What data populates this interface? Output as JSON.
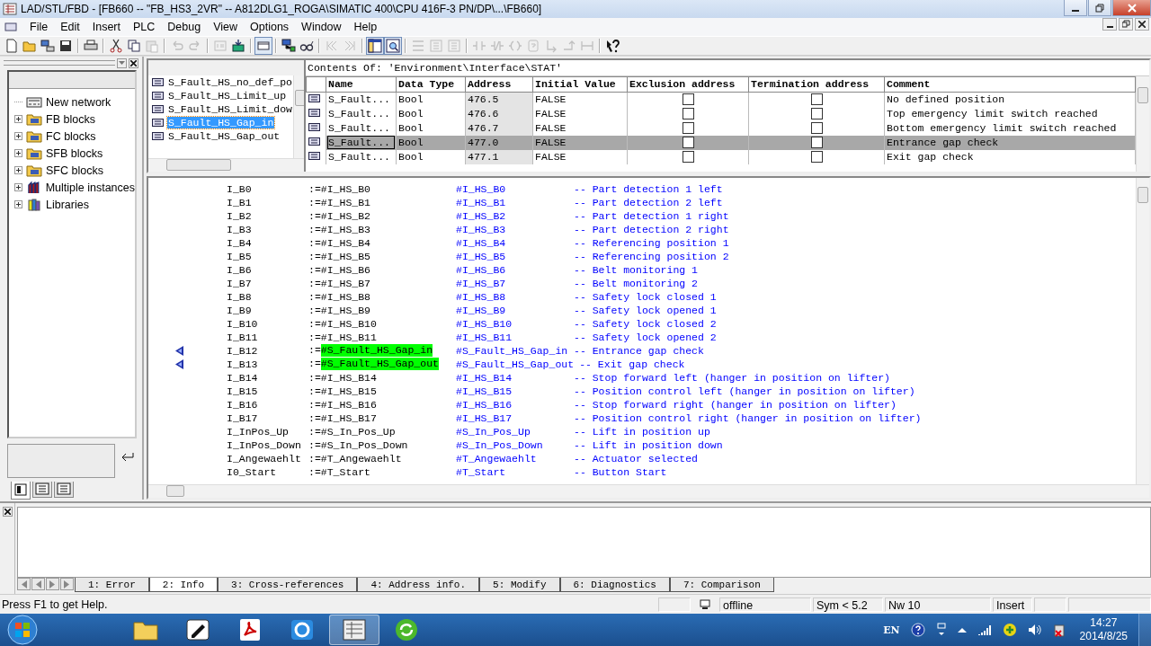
{
  "window": {
    "title": "LAD/STL/FBD  - [FB660 -- \"FB_HS3_2VR\" -- A812DLG1_ROGA\\SIMATIC 400\\CPU 416F-3 PN/DP\\...\\FB660]"
  },
  "menu": [
    "File",
    "Edit",
    "Insert",
    "PLC",
    "Debug",
    "View",
    "Options",
    "Window",
    "Help"
  ],
  "toolbar": [
    [
      {
        "kind": "new",
        "disabled": false,
        "pressed": false
      },
      {
        "kind": "open",
        "disabled": false,
        "pressed": false
      },
      {
        "kind": "nodes",
        "disabled": false,
        "pressed": false
      },
      {
        "kind": "save",
        "disabled": false,
        "pressed": false
      }
    ],
    [
      {
        "kind": "print",
        "disabled": false,
        "pressed": false
      }
    ],
    [
      {
        "kind": "cut",
        "disabled": false,
        "pressed": false
      },
      {
        "kind": "copy",
        "disabled": false,
        "pressed": false
      },
      {
        "kind": "paste",
        "disabled": true,
        "pressed": false
      }
    ],
    [
      {
        "kind": "undo",
        "disabled": true,
        "pressed": false
      },
      {
        "kind": "redo",
        "disabled": true,
        "pressed": false
      }
    ],
    [
      {
        "kind": "compile",
        "disabled": true,
        "pressed": false
      },
      {
        "kind": "download",
        "disabled": false,
        "pressed": false
      }
    ],
    [
      {
        "kind": "window",
        "disabled": false,
        "pressed": true
      }
    ],
    [
      {
        "kind": "network",
        "disabled": false,
        "pressed": false
      },
      {
        "kind": "glasses",
        "disabled": false,
        "pressed": false
      }
    ],
    [
      {
        "kind": "prev",
        "disabled": true,
        "pressed": false
      },
      {
        "kind": "next",
        "disabled": true,
        "pressed": false
      }
    ],
    [
      {
        "kind": "panel",
        "disabled": false,
        "pressed": true
      },
      {
        "kind": "zoom",
        "disabled": false,
        "pressed": true
      }
    ],
    [
      {
        "kind": "rung",
        "disabled": true,
        "pressed": false
      },
      {
        "kind": "branch",
        "disabled": true,
        "pressed": false
      },
      {
        "kind": "branch",
        "disabled": true,
        "pressed": false
      }
    ],
    [
      {
        "kind": "contact",
        "disabled": true,
        "pressed": false
      },
      {
        "kind": "ncontact",
        "disabled": true,
        "pressed": false
      },
      {
        "kind": "coil",
        "disabled": true,
        "pressed": false
      },
      {
        "kind": "box",
        "disabled": true,
        "pressed": false
      },
      {
        "kind": "open-branch",
        "disabled": true,
        "pressed": false
      },
      {
        "kind": "close-branch",
        "disabled": true,
        "pressed": false
      },
      {
        "kind": "jump",
        "disabled": true,
        "pressed": false
      }
    ],
    [
      {
        "kind": "help",
        "disabled": false,
        "pressed": false
      }
    ]
  ],
  "catalog": {
    "tree": [
      {
        "label": "New network",
        "kind": "network",
        "expandable": false
      },
      {
        "label": "FB blocks",
        "kind": "folder",
        "expandable": true
      },
      {
        "label": "FC blocks",
        "kind": "folder",
        "expandable": true
      },
      {
        "label": "SFB blocks",
        "kind": "folder",
        "expandable": true
      },
      {
        "label": "SFC blocks",
        "kind": "folder",
        "expandable": true
      },
      {
        "label": "Multiple instances",
        "kind": "instances",
        "expandable": true
      },
      {
        "label": "Libraries",
        "kind": "library",
        "expandable": true
      }
    ],
    "tabs": [
      {
        "kind": "catalog",
        "selected": true
      },
      {
        "kind": "list",
        "selected": false
      },
      {
        "kind": "list",
        "selected": false
      }
    ]
  },
  "interface": {
    "items": [
      {
        "label": "S_Fault_HS_no_def_po",
        "selected": false
      },
      {
        "label": "S_Fault_HS_Limit_up",
        "selected": false
      },
      {
        "label": "S_Fault_HS_Limit_dow",
        "selected": false
      },
      {
        "label": "S_Fault_HS_Gap_in",
        "selected": true
      },
      {
        "label": "S_Fault_HS_Gap_out",
        "selected": false
      }
    ],
    "header": "Contents Of: 'Environment\\Interface\\STAT'",
    "columns": [
      "Name",
      "Data Type",
      "Address",
      "Initial Value",
      "Exclusion address",
      "Termination address",
      "Comment"
    ],
    "rows": [
      {
        "name": "S_Fault...",
        "type": "Bool",
        "address": "476.5",
        "initial": "FALSE",
        "exclusion": false,
        "termination": false,
        "comment": "No defined position",
        "selected": false
      },
      {
        "name": "S_Fault...",
        "type": "Bool",
        "address": "476.6",
        "initial": "FALSE",
        "exclusion": false,
        "termination": false,
        "comment": "Top emergency limit switch reached",
        "selected": false
      },
      {
        "name": "S_Fault...",
        "type": "Bool",
        "address": "476.7",
        "initial": "FALSE",
        "exclusion": false,
        "termination": false,
        "comment": "Bottom emergency limit switch reached",
        "selected": false
      },
      {
        "name": "S_Fault...",
        "type": "Bool",
        "address": "477.0",
        "initial": "FALSE",
        "exclusion": false,
        "termination": false,
        "comment": "Entrance gap check",
        "selected": true
      },
      {
        "name": "S_Fault...",
        "type": "Bool",
        "address": "477.1",
        "initial": "FALSE",
        "exclusion": false,
        "termination": false,
        "comment": "Exit gap check",
        "selected": false
      }
    ]
  },
  "code": [
    {
      "param": "I_B0",
      "op": ":=",
      "value": "#I_HS_B0",
      "actual": "#I_HS_B0",
      "comment": "-- Part detection 1 left",
      "marked": false,
      "highlighted": false
    },
    {
      "param": "I_B1",
      "op": ":=",
      "value": "#I_HS_B1",
      "actual": "#I_HS_B1",
      "comment": "-- Part detection 2 left",
      "marked": false,
      "highlighted": false
    },
    {
      "param": "I_B2",
      "op": ":=",
      "value": "#I_HS_B2",
      "actual": "#I_HS_B2",
      "comment": "-- Part detection 1 right",
      "marked": false,
      "highlighted": false
    },
    {
      "param": "I_B3",
      "op": ":=",
      "value": "#I_HS_B3",
      "actual": "#I_HS_B3",
      "comment": "-- Part detection 2 right",
      "marked": false,
      "highlighted": false
    },
    {
      "param": "I_B4",
      "op": ":=",
      "value": "#I_HS_B4",
      "actual": "#I_HS_B4",
      "comment": "-- Referencing position 1",
      "marked": false,
      "highlighted": false
    },
    {
      "param": "I_B5",
      "op": ":=",
      "value": "#I_HS_B5",
      "actual": "#I_HS_B5",
      "comment": "-- Referencing position 2",
      "marked": false,
      "highlighted": false
    },
    {
      "param": "I_B6",
      "op": ":=",
      "value": "#I_HS_B6",
      "actual": "#I_HS_B6",
      "comment": "-- Belt monitoring 1",
      "marked": false,
      "highlighted": false
    },
    {
      "param": "I_B7",
      "op": ":=",
      "value": "#I_HS_B7",
      "actual": "#I_HS_B7",
      "comment": "-- Belt monitoring 2",
      "marked": false,
      "highlighted": false
    },
    {
      "param": "I_B8",
      "op": ":=",
      "value": "#I_HS_B8",
      "actual": "#I_HS_B8",
      "comment": "-- Safety lock closed 1",
      "marked": false,
      "highlighted": false
    },
    {
      "param": "I_B9",
      "op": ":=",
      "value": "#I_HS_B9",
      "actual": "#I_HS_B9",
      "comment": "-- Safety lock opened 1",
      "marked": false,
      "highlighted": false
    },
    {
      "param": "I_B10",
      "op": ":=",
      "value": "#I_HS_B10",
      "actual": "#I_HS_B10",
      "comment": "-- Safety lock closed 2",
      "marked": false,
      "highlighted": false
    },
    {
      "param": "I_B11",
      "op": ":=",
      "value": "#I_HS_B11",
      "actual": "#I_HS_B11",
      "comment": "-- Safety lock opened 2",
      "marked": false,
      "highlighted": false
    },
    {
      "param": "I_B12",
      "op": ":=",
      "value": "#S_Fault_HS_Gap_in",
      "actual": "#S_Fault_HS_Gap_in",
      "comment": "-- Entrance gap check",
      "marked": true,
      "highlighted": true
    },
    {
      "param": "I_B13",
      "op": ":=",
      "value": "#S_Fault_HS_Gap_out",
      "actual": "#S_Fault_HS_Gap_out",
      "comment": "-- Exit gap check",
      "marked": true,
      "highlighted": true
    },
    {
      "param": "I_B14",
      "op": ":=",
      "value": "#I_HS_B14",
      "actual": "#I_HS_B14",
      "comment": "-- Stop forward left (hanger in position on lifter)",
      "marked": false,
      "highlighted": false
    },
    {
      "param": "I_B15",
      "op": ":=",
      "value": "#I_HS_B15",
      "actual": "#I_HS_B15",
      "comment": "-- Position control left (hanger in position on lifter)",
      "marked": false,
      "highlighted": false
    },
    {
      "param": "I_B16",
      "op": ":=",
      "value": "#I_HS_B16",
      "actual": "#I_HS_B16",
      "comment": "-- Stop forward right (hanger in position on lifter)",
      "marked": false,
      "highlighted": false
    },
    {
      "param": "I_B17",
      "op": ":=",
      "value": "#I_HS_B17",
      "actual": "#I_HS_B17",
      "comment": "-- Position control right (hanger in position on lifter)",
      "marked": false,
      "highlighted": false
    },
    {
      "param": "I_InPos_Up",
      "op": ":=",
      "value": "#S_In_Pos_Up",
      "actual": "#S_In_Pos_Up",
      "comment": "-- Lift in position up",
      "marked": false,
      "highlighted": false
    },
    {
      "param": "I_InPos_Down",
      "op": ":=",
      "value": "#S_In_Pos_Down",
      "actual": "#S_In_Pos_Down",
      "comment": "-- Lift in position down",
      "marked": false,
      "highlighted": false
    },
    {
      "param": "I_Angewaehlt",
      "op": ":=",
      "value": "#T_Angewaehlt",
      "actual": "#T_Angewaehlt",
      "comment": "-- Actuator selected",
      "marked": false,
      "highlighted": false
    },
    {
      "param": "I0_Start",
      "op": ":=",
      "value": "#T_Start",
      "actual": "#T_Start",
      "comment": "-- Button Start",
      "marked": false,
      "highlighted": false
    }
  ],
  "details": {
    "tabs": [
      {
        "label": "1: Error",
        "selected": false
      },
      {
        "label": "2: Info",
        "selected": true
      },
      {
        "label": "3: Cross-references",
        "selected": false
      },
      {
        "label": "4: Address info.",
        "selected": false
      },
      {
        "label": "5: Modify",
        "selected": false
      },
      {
        "label": "6: Diagnostics",
        "selected": false
      },
      {
        "label": "7: Comparison",
        "selected": false
      }
    ]
  },
  "status_bar": {
    "help": "Press F1 to get Help.",
    "mode": "offline",
    "symbols": "Sym < 5.2",
    "network": "Nw 10",
    "edit_mode": "Insert"
  },
  "taskbar": {
    "apps": [
      {
        "kind": "folder",
        "active": false
      },
      {
        "kind": "pen",
        "active": false
      },
      {
        "kind": "pdf",
        "active": false
      },
      {
        "kind": "chat",
        "active": false
      },
      {
        "kind": "plc",
        "active": true
      },
      {
        "kind": "refresh",
        "active": false
      }
    ],
    "language": "EN",
    "time": "14:27",
    "date": "2014/8/25"
  }
}
